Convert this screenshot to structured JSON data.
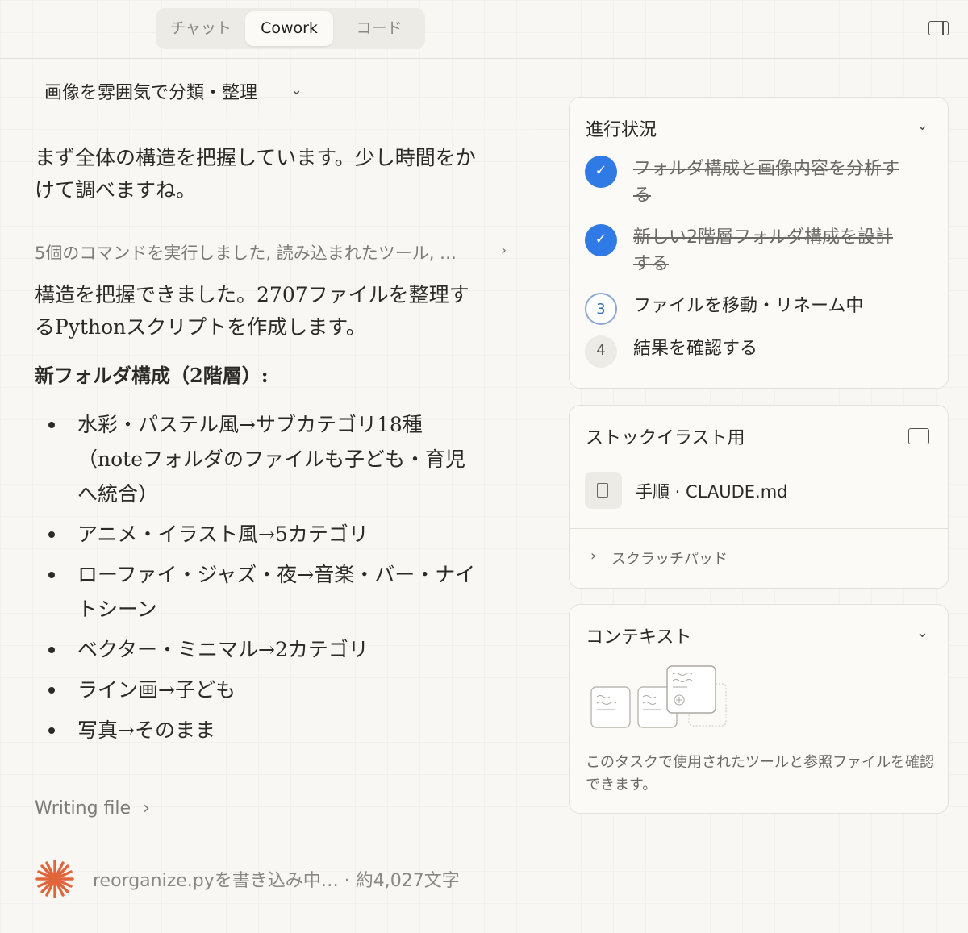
{
  "header": {
    "tabs": [
      {
        "label": "チャット",
        "active": false
      },
      {
        "label": "Cowork",
        "active": true
      },
      {
        "label": "コード",
        "active": false
      }
    ],
    "panel_toggle_icon": "sidebar-panel-icon"
  },
  "task": {
    "title": "画像を雰囲気で分類・整理"
  },
  "conversation": {
    "message1": "まず全体の構造を把握しています。少し時間をかけて調べますね。",
    "command_summary": "5個のコマンドを実行しました, 読み込まれたツール, …",
    "message2": "構造を把握できました。2707ファイルを整理するPythonスクリプトを作成します。",
    "heading": "新フォルダ構成（2階層）:",
    "bullets": [
      "水彩・パステル風→サブカテゴリ18種（noteフォルダのファイルも子ども・育児へ統合）",
      "アニメ・イラスト風→5カテゴリ",
      "ローファイ・ジャズ・夜→音楽・バー・ナイトシーン",
      "ベクター・ミニマル→2カテゴリ",
      "ライン画→子ども",
      "写真→そのまま"
    ],
    "writing_file": "Writing file",
    "status": "reorganize.pyを書き込み中…  ·  約4,027文字"
  },
  "progress": {
    "title": "進行状況",
    "steps": [
      {
        "mark": "",
        "label": "フォルダ構成と画像内容を分析する",
        "state": "done"
      },
      {
        "mark": "",
        "label": "新しい2階層フォルダ構成を設計する",
        "state": "done"
      },
      {
        "mark": "3",
        "label": "ファイルを移動・リネーム中",
        "state": "current"
      },
      {
        "mark": "4",
        "label": "結果を確認する",
        "state": "pending"
      }
    ]
  },
  "stock": {
    "title": "ストックイラスト用",
    "file": "手順 · CLAUDE.md",
    "scratchpad": "スクラッチパッド"
  },
  "context": {
    "title": "コンテキスト",
    "description": "このタスクで使用されたツールと参照ファイルを確認できます。"
  },
  "colors": {
    "accent": "#2f7ae5",
    "spark": "#e0653a",
    "background": "#f8f7f3"
  }
}
